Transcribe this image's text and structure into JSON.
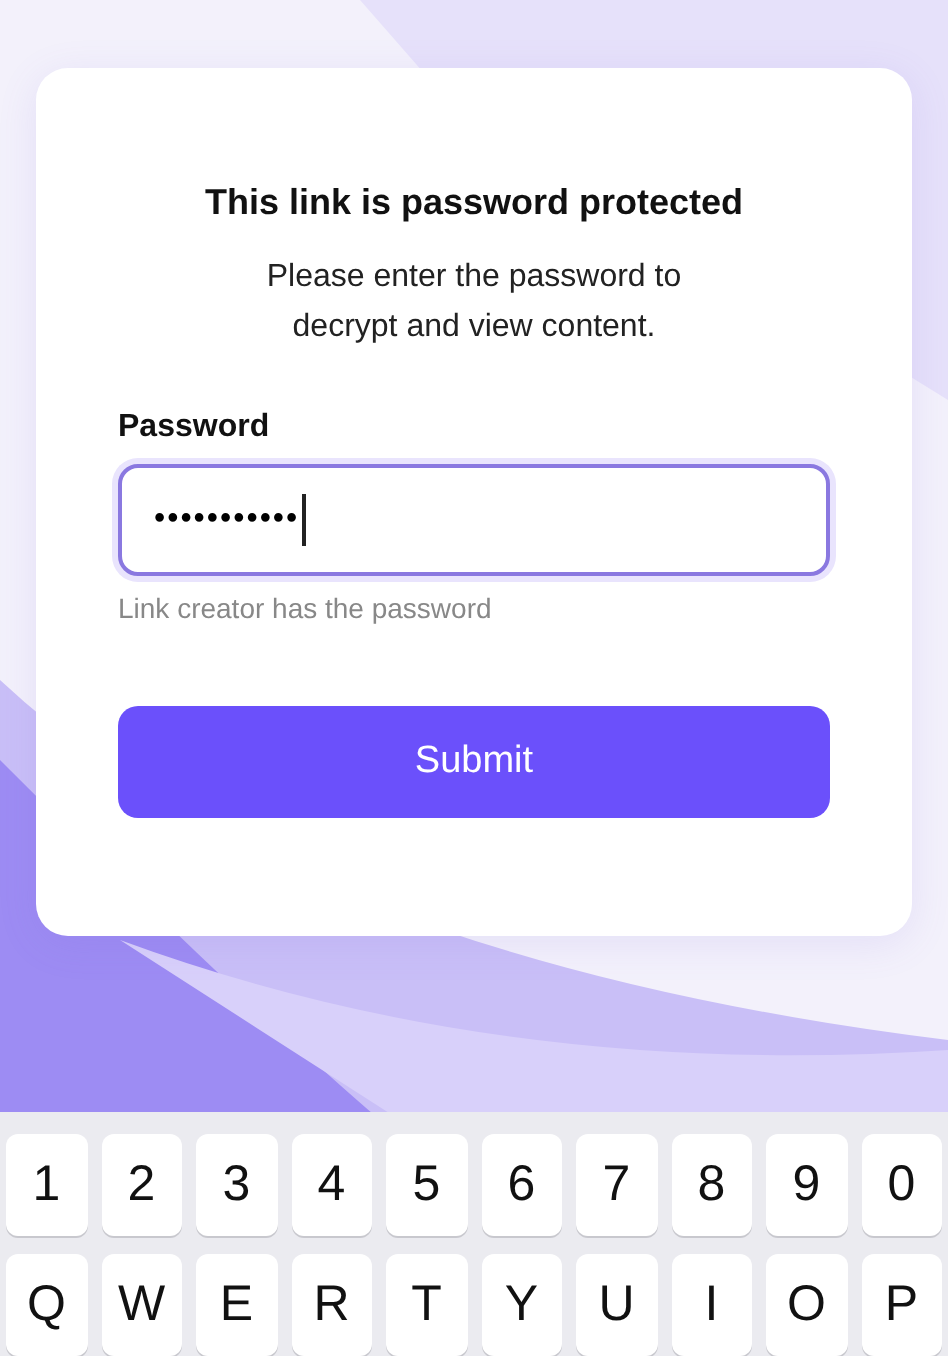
{
  "dialog": {
    "title": "This link is password protected",
    "message": "Please enter the password to decrypt and view content.",
    "field": {
      "label": "Password",
      "value": "•••••••••••",
      "focused": true,
      "hint": "Link creator has the password"
    },
    "submit": "Submit"
  },
  "keyboard": {
    "rows": [
      [
        "1",
        "2",
        "3",
        "4",
        "5",
        "6",
        "7",
        "8",
        "9",
        "0"
      ],
      [
        "Q",
        "W",
        "E",
        "R",
        "T",
        "Y",
        "U",
        "I",
        "O",
        "P"
      ]
    ]
  }
}
